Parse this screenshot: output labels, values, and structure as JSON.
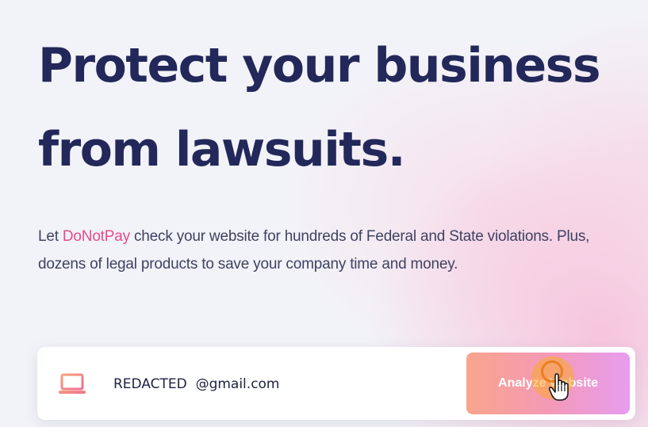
{
  "hero": {
    "headline_line1": "Protect your business",
    "headline_line2": "from lawsuits.",
    "subtext_prefix": "Let ",
    "brand_name": "DoNotPay",
    "subtext_body": " check your website for hundreds of Federal and State violations. Plus, dozens of legal products to save your company time and money."
  },
  "form": {
    "icon": "laptop-icon",
    "input_value": "REDACTED  @gmail.com",
    "button_label": "Analyze Website"
  },
  "colors": {
    "headline": "#23285a",
    "brand": "#e94a8a",
    "button_gradient_start": "#f9a48c",
    "button_gradient_end": "#e79cf0",
    "icon": "#f07a80"
  }
}
